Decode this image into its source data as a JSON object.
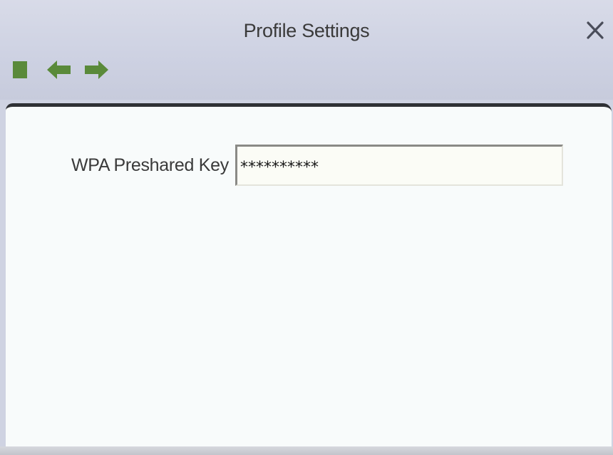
{
  "window": {
    "title": "Profile Settings"
  },
  "toolbar": {
    "buttons": [
      {
        "name": "stop-icon",
        "color": "#5a8a3a"
      },
      {
        "name": "back-arrow-icon",
        "color": "#5a8a3a"
      },
      {
        "name": "forward-arrow-icon",
        "color": "#5a8a3a"
      }
    ]
  },
  "form": {
    "wpa_key_label": "WPA Preshared Key",
    "wpa_key_value": "**********"
  },
  "icons": {
    "close": "close-icon"
  },
  "colors": {
    "accent_green": "#5a8a3a",
    "titlebar": "#cdd1e2",
    "content_bg": "#f8fbfb"
  }
}
